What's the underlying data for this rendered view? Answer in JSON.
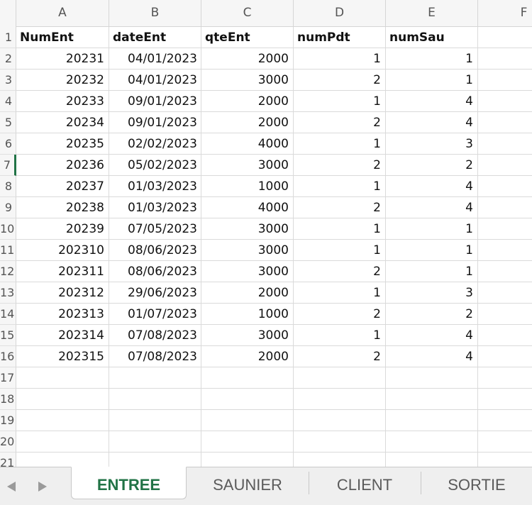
{
  "columns": [
    "A",
    "B",
    "C",
    "D",
    "E",
    "F"
  ],
  "row_numbers": [
    "1",
    "2",
    "3",
    "4",
    "5",
    "6",
    "7",
    "8",
    "9",
    "10",
    "11",
    "12",
    "13",
    "14",
    "15",
    "16",
    "17",
    "18",
    "19",
    "20",
    "21"
  ],
  "headers": [
    "NumEnt",
    "dateEnt",
    "qteEnt",
    "numPdt",
    "numSau"
  ],
  "rows": [
    [
      "20231",
      "04/01/2023",
      "2000",
      "1",
      "1"
    ],
    [
      "20232",
      "04/01/2023",
      "3000",
      "2",
      "1"
    ],
    [
      "20233",
      "09/01/2023",
      "2000",
      "1",
      "4"
    ],
    [
      "20234",
      "09/01/2023",
      "2000",
      "2",
      "4"
    ],
    [
      "20235",
      "02/02/2023",
      "4000",
      "1",
      "3"
    ],
    [
      "20236",
      "05/02/2023",
      "3000",
      "2",
      "2"
    ],
    [
      "20237",
      "01/03/2023",
      "1000",
      "1",
      "4"
    ],
    [
      "20238",
      "01/03/2023",
      "4000",
      "2",
      "4"
    ],
    [
      "20239",
      "07/05/2023",
      "3000",
      "1",
      "1"
    ],
    [
      "202310",
      "08/06/2023",
      "3000",
      "1",
      "1"
    ],
    [
      "202311",
      "08/06/2023",
      "3000",
      "2",
      "1"
    ],
    [
      "202312",
      "29/06/2023",
      "2000",
      "1",
      "3"
    ],
    [
      "202313",
      "01/07/2023",
      "1000",
      "2",
      "2"
    ],
    [
      "202314",
      "07/08/2023",
      "3000",
      "1",
      "4"
    ],
    [
      "202315",
      "07/08/2023",
      "2000",
      "2",
      "4"
    ]
  ],
  "selected_row": "7",
  "tabs": [
    {
      "label": "ENTREE",
      "active": true
    },
    {
      "label": "SAUNIER",
      "active": false
    },
    {
      "label": "CLIENT",
      "active": false
    },
    {
      "label": "SORTIE",
      "active": false
    }
  ],
  "colors": {
    "accent": "#217346",
    "grid": "#dadada",
    "header_bg": "#f6f6f6"
  },
  "icons": {
    "prev": "triangle-left-icon",
    "next": "triangle-right-icon"
  }
}
